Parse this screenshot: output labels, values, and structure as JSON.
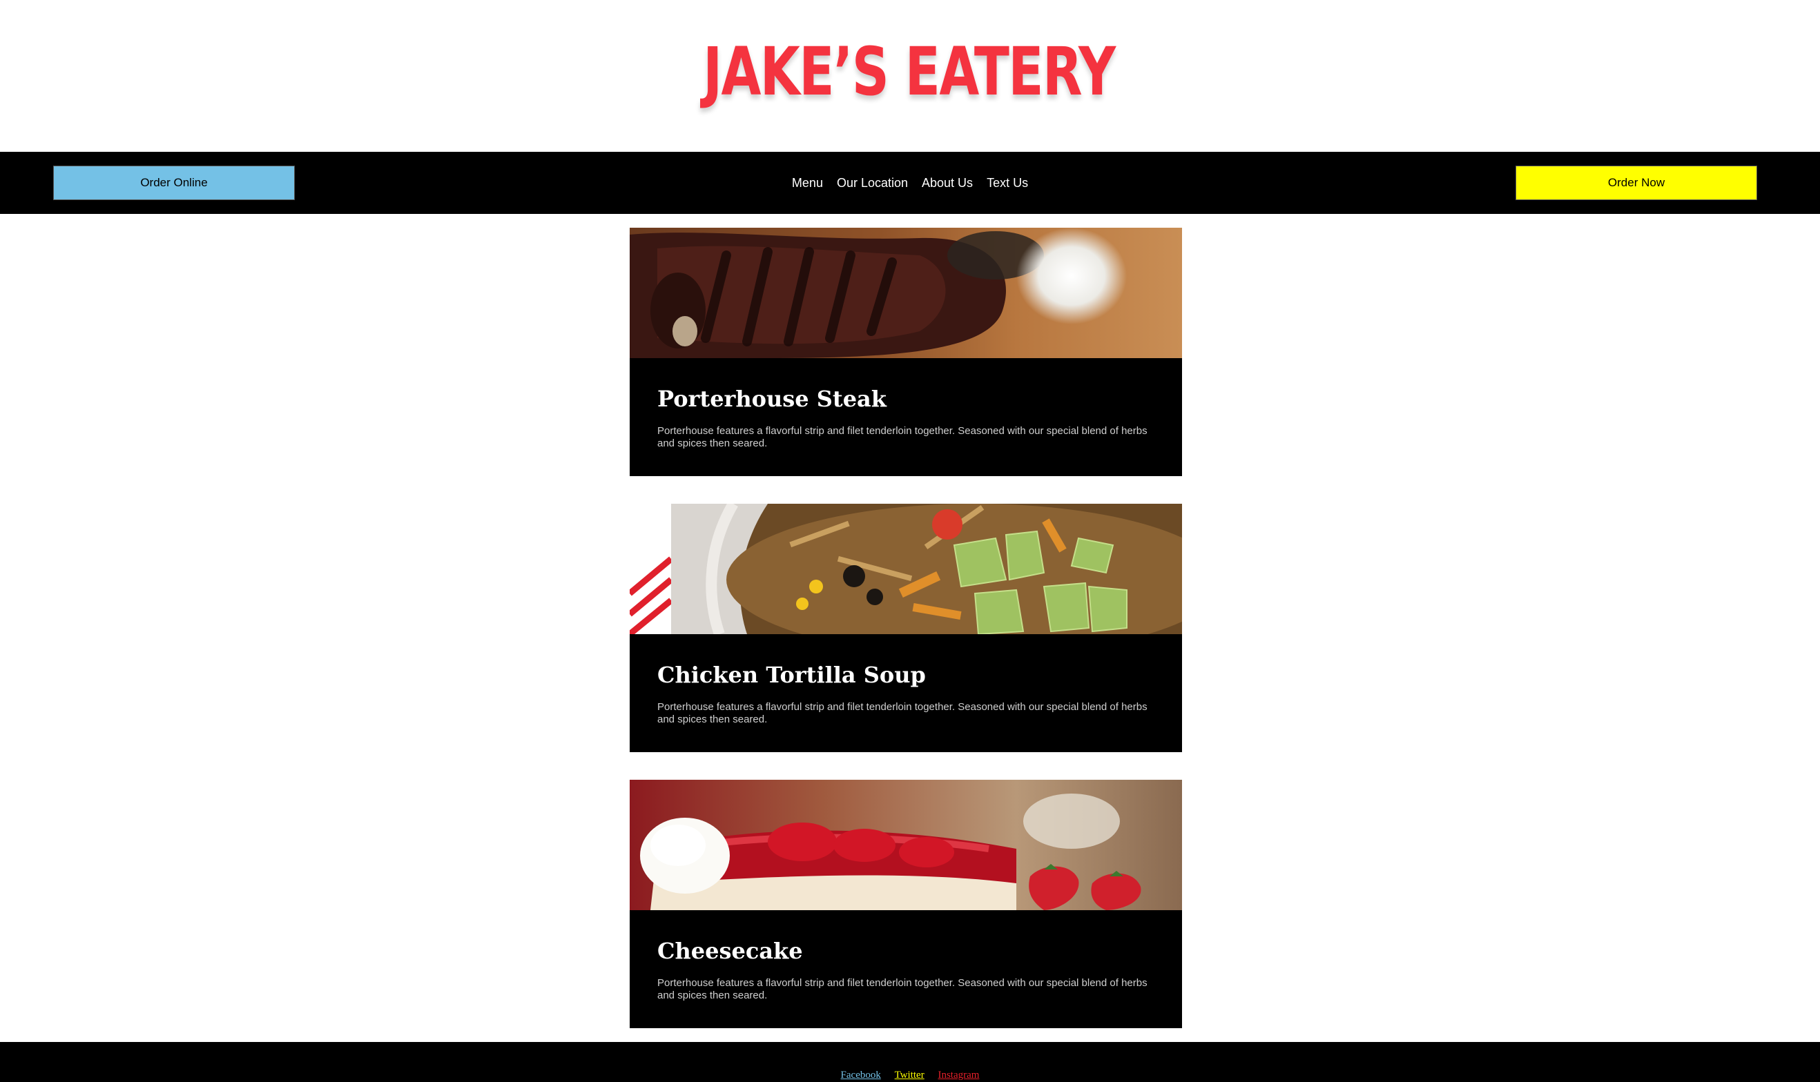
{
  "header": {
    "logo_text": "JAKE’S EATERY",
    "logo_color": "#f4333f"
  },
  "nav": {
    "order_online_label": "Order Online",
    "order_online_color": "#74c1e6",
    "order_now_label": "Order Now",
    "order_now_color": "#ffff00",
    "links": [
      {
        "label": "Menu"
      },
      {
        "label": "Our Location"
      },
      {
        "label": "About Us"
      },
      {
        "label": "Text Us"
      }
    ]
  },
  "menu": {
    "items": [
      {
        "image_name": "porterhouse-steak-image",
        "title": "Porterhouse Steak",
        "description": "Porterhouse features a flavorful strip and filet tenderloin together. Seasoned with our special blend of herbs and spices then seared."
      },
      {
        "image_name": "chicken-tortilla-soup-image",
        "title": "Chicken Tortilla Soup",
        "description": "Porterhouse features a flavorful strip and filet tenderloin together. Seasoned with our special blend of herbs and spices then seared."
      },
      {
        "image_name": "cheesecake-image",
        "title": "Cheesecake",
        "description": "Porterhouse features a flavorful strip and filet tenderloin together. Seasoned with our special blend of herbs and spices then seared."
      }
    ]
  },
  "footer": {
    "links": [
      {
        "label": "Facebook",
        "color": "#74c1e6"
      },
      {
        "label": "Twitter",
        "color": "#ffff00"
      },
      {
        "label": "Instagram",
        "color": "#e8202a"
      }
    ]
  }
}
